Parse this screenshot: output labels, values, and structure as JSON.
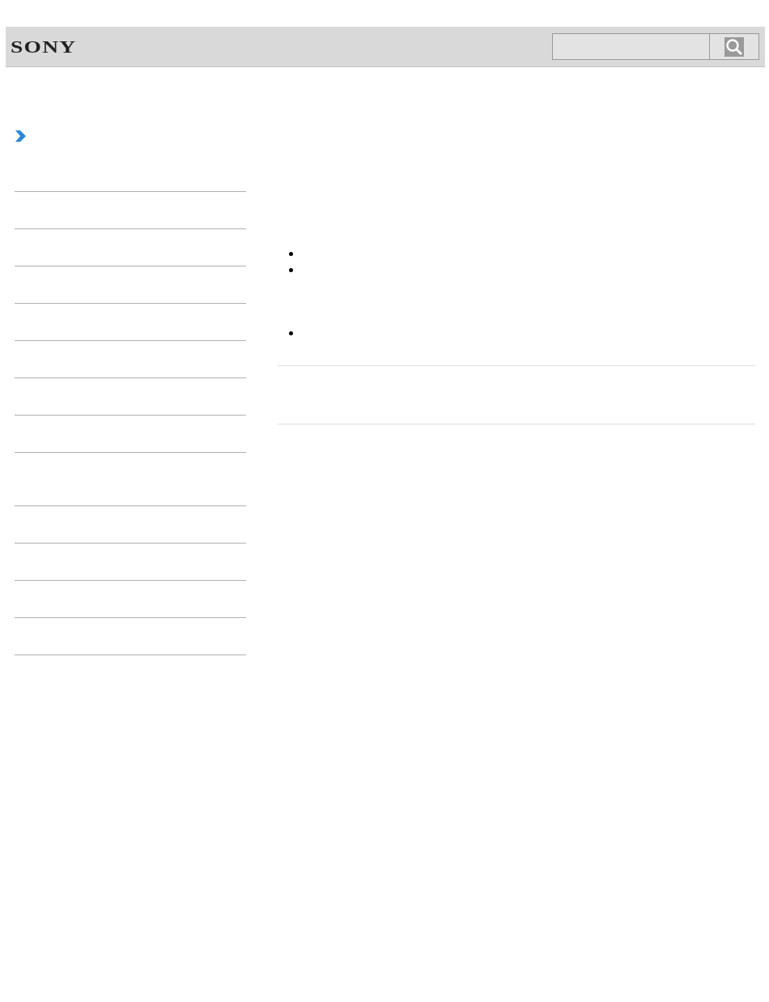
{
  "header": {
    "logo": "SONY"
  },
  "sidebar": {
    "items": [
      {
        "kind": "row"
      },
      {
        "kind": "row"
      },
      {
        "kind": "row"
      },
      {
        "kind": "row"
      },
      {
        "kind": "row"
      },
      {
        "kind": "row"
      },
      {
        "kind": "row"
      },
      {
        "kind": "tall"
      },
      {
        "kind": "row"
      },
      {
        "kind": "row"
      },
      {
        "kind": "row"
      },
      {
        "kind": "row"
      }
    ]
  },
  "content": {
    "blocks": [
      {
        "kind": "bullet"
      },
      {
        "kind": "bullet"
      },
      {
        "kind": "spacer"
      },
      {
        "kind": "bullet"
      }
    ]
  }
}
